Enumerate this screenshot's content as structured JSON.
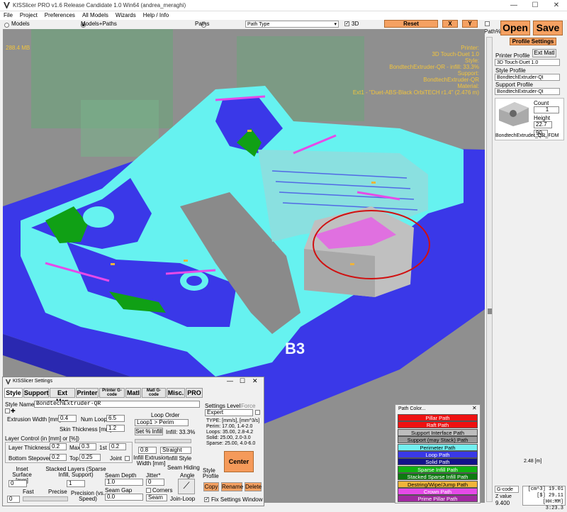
{
  "window": {
    "title": "KISSlicer PRO v1.6 Release Candidate 1.0 Win64 (andrea_meraghi)"
  },
  "menu": [
    "File",
    "Project",
    "Preferences",
    "All Models",
    "Wizards",
    "Help / Info"
  ],
  "toolbar": {
    "models": "Models",
    "models_paths": "Models+Paths",
    "paths": "Paths",
    "path_type": "Path Type",
    "threed": "3D",
    "reset": "Reset",
    "x": "X",
    "y": "Y",
    "path_pct": "Path%",
    "open": "Open",
    "save": "Save"
  },
  "viewport": {
    "memory": "288.4 MB",
    "info": [
      "Printer:",
      "3D Touch-Duet 1.0",
      "Style:",
      "BondtechExtruder-QR - infill: 33.3%",
      "Support:",
      "BondtechExtruder-QR",
      "Material:",
      "Ext1 - \"Duet-ABS-Black OrbiTECH r1.4\" (2.476 m)"
    ],
    "colors": {
      "overlay_text": "#f2c43c",
      "base": "#3a38e8",
      "cyan": "#66f2f0",
      "green": "#0f8a14",
      "pink": "#e64ae8"
    }
  },
  "right_panel": {
    "profile_settings": "Profile Settings",
    "printer_profile_label": "Printer Profile",
    "ext_matl": "Ext Matl",
    "printer_profile": "3D Touch-Duet 1.0",
    "style_profile_label": "Style Profile",
    "style_profile": "BondtechExtruder-QI",
    "support_profile_label": "Support Profile",
    "support_profile": "BondtechExtruder-QI",
    "count_label": "Count",
    "count": "1",
    "height_label": "Height",
    "height": "22.7",
    "rotation": "90",
    "model_name": "BondtechExtruder_QR_FDM",
    "length": "2.48 [m]",
    "gcode": "G-code",
    "z_value_label": "Z value",
    "z_value": "9.400",
    "stats": [
      "[cm^3] 19.01",
      "[$] 29.11",
      "[HH:MM] 3:23.3"
    ]
  },
  "settings": {
    "title": "KISSlicer Settings",
    "tabs": [
      "Style",
      "Support",
      "Ext Map",
      "Printer",
      "Printer G-code",
      "Matl",
      "Matl G-code",
      "Misc.",
      "PRO"
    ],
    "style_name_label": "Style Name",
    "style_name": "BondtechExtruder-QR",
    "extrusion_width_label": "Extrusion Width [mm]",
    "extrusion_width": "0.4",
    "num_loops_label": "Num Loops",
    "num_loops": "6.5",
    "loop_order_label": "Loop Order",
    "loop_order": "Loop1 > Perim",
    "skin_thickness_label": "Skin Thickness [mm]",
    "skin_thickness": "1.2",
    "set_pct_infill": "Set % Infill",
    "infill_pct": "Infill: 33.3%",
    "layer_control": "Layer Control (in [mm] or [%])",
    "layer_thickness_label": "Layer Thickness",
    "layer_thickness": "0.2",
    "max_label": "Max",
    "max": "0.3",
    "first_label": "1st",
    "first": "0.2",
    "bottom_stepover_label": "Bottom Stepover",
    "bottom_stepover": "0.2",
    "top_label": "Top",
    "top": "0.25",
    "joint_label": "Joint",
    "infill_width": "0.8",
    "infill_style": "Straight",
    "infill_extrusion_label": "Infill Extrusion Width [mm]",
    "infill_style_label": "Infill Style",
    "inset_label": "Inset Surface [mm]",
    "inset": "0",
    "stacked_label": "Stacked Layers (Sparse Infill, Support)",
    "stacked": "1",
    "seam_depth_label": "Seam Depth",
    "seam_depth": "1.0",
    "jitter_label": "Jitter*",
    "jitter": "0",
    "seam_hiding_label": "Seam Hiding",
    "angle_label": "Angle",
    "seam_gap_label": "Seam Gap",
    "seam_gap": "0.0",
    "corners_label": "Corners",
    "seam_sel": "Seam",
    "join_loop": "Join-Loop",
    "fast": "Fast",
    "precise": "Precise",
    "precision_label": "Precision (vs. Speed)",
    "precision_value": "0",
    "settings_level_label": "Settings Level",
    "force_label": "Force",
    "settings_level": "Expert",
    "speeds": [
      "TYPE: [mm/s], [mm^3/s]",
      "Perim: 17.00, 1.4-2.0",
      "Loops: 35.00, 2.8-4.2",
      "Solid: 25.00, 2.0-3.0",
      "Sparse: 25.00, 4.0-6.0"
    ],
    "center": "Center",
    "style_profile_label": "Style Profile",
    "copy": "Copy",
    "rename": "Rename",
    "delete": "Delete",
    "fix_window": "Fix Settings Window"
  },
  "path_color": {
    "title": "Path Color...",
    "items": [
      {
        "label": "Pillar Path",
        "bg": "#ee1111",
        "fg": "#ffffff"
      },
      {
        "label": "Raft Path",
        "bg": "#ee1111",
        "fg": "#ffffff"
      },
      {
        "label": "Support Interface Path",
        "bg": "#bdbdbd",
        "fg": "#000000"
      },
      {
        "label": "Support (may Stack) Path",
        "bg": "#9a9a9a",
        "fg": "#000000"
      },
      {
        "label": "Perimeter Path",
        "bg": "#73f0f0",
        "fg": "#000000"
      },
      {
        "label": "Loop Path",
        "bg": "#3a38e8",
        "fg": "#ffffff"
      },
      {
        "label": "Solid Path",
        "bg": "#12128a",
        "fg": "#ffffff"
      },
      {
        "label": "Sparse Infill Path",
        "bg": "#10b010",
        "fg": "#ffffff"
      },
      {
        "label": "Stacked Sparse Infill Path",
        "bg": "#0d7a10",
        "fg": "#ffffff"
      },
      {
        "label": "Destring/Wipe/Jump Path",
        "bg": "#f0b43a",
        "fg": "#000000"
      },
      {
        "label": "Crown Path",
        "bg": "#e64ae8",
        "fg": "#ffffff"
      },
      {
        "label": "Prime Pillar Path",
        "bg": "#a02aa0",
        "fg": "#ffffff"
      }
    ]
  }
}
